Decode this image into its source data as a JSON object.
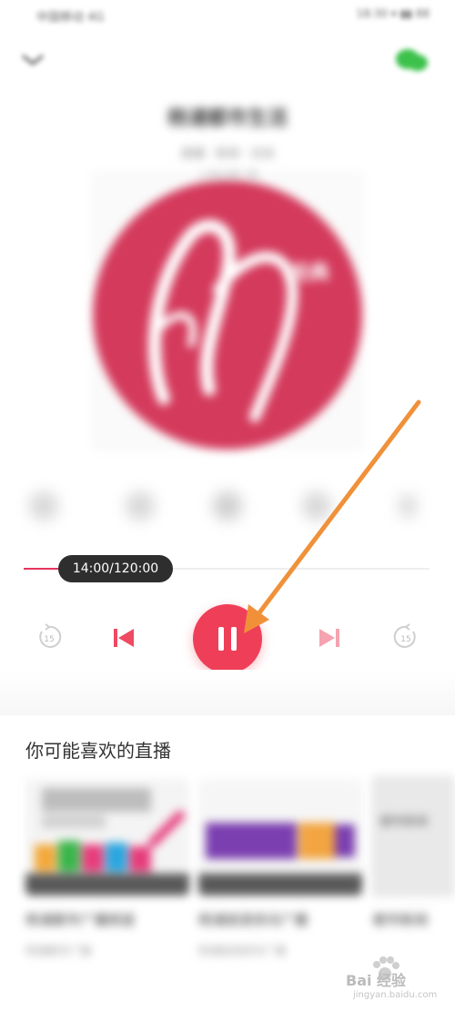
{
  "status_bar": {
    "left_text": "中国移动 4G",
    "right_text": "18:30 ▾ ▮▮ 88"
  },
  "header": {
    "title": "杨浦都市生活",
    "subtitle": "直播 · 新闻 · 访谈",
    "tag": "上海交通广播"
  },
  "cover": {
    "logo_label": "经典"
  },
  "player": {
    "time_display": "14:00/120:00",
    "progress_fraction": 0.1167,
    "rewind_label": "15",
    "forward_label": "15"
  },
  "recommendations": {
    "section_title": "你可能喜欢的直播",
    "cards": [
      {
        "title": "杨浦都市广播频道",
        "subtitle": "杨浦都市广播"
      },
      {
        "title": "杨浦旅游资讯广播",
        "subtitle": "杨浦旅游资讯广播"
      },
      {
        "title": "都市新闻",
        "subtitle": ""
      }
    ],
    "card3_inner_text": "都市新闻"
  },
  "watermark": {
    "brand": "Bai 经验",
    "url": "jingyan.baidu.com"
  },
  "colors": {
    "accent": "#ef3f58",
    "arrow": "#f0913a",
    "share_green": "#3cc14b"
  }
}
